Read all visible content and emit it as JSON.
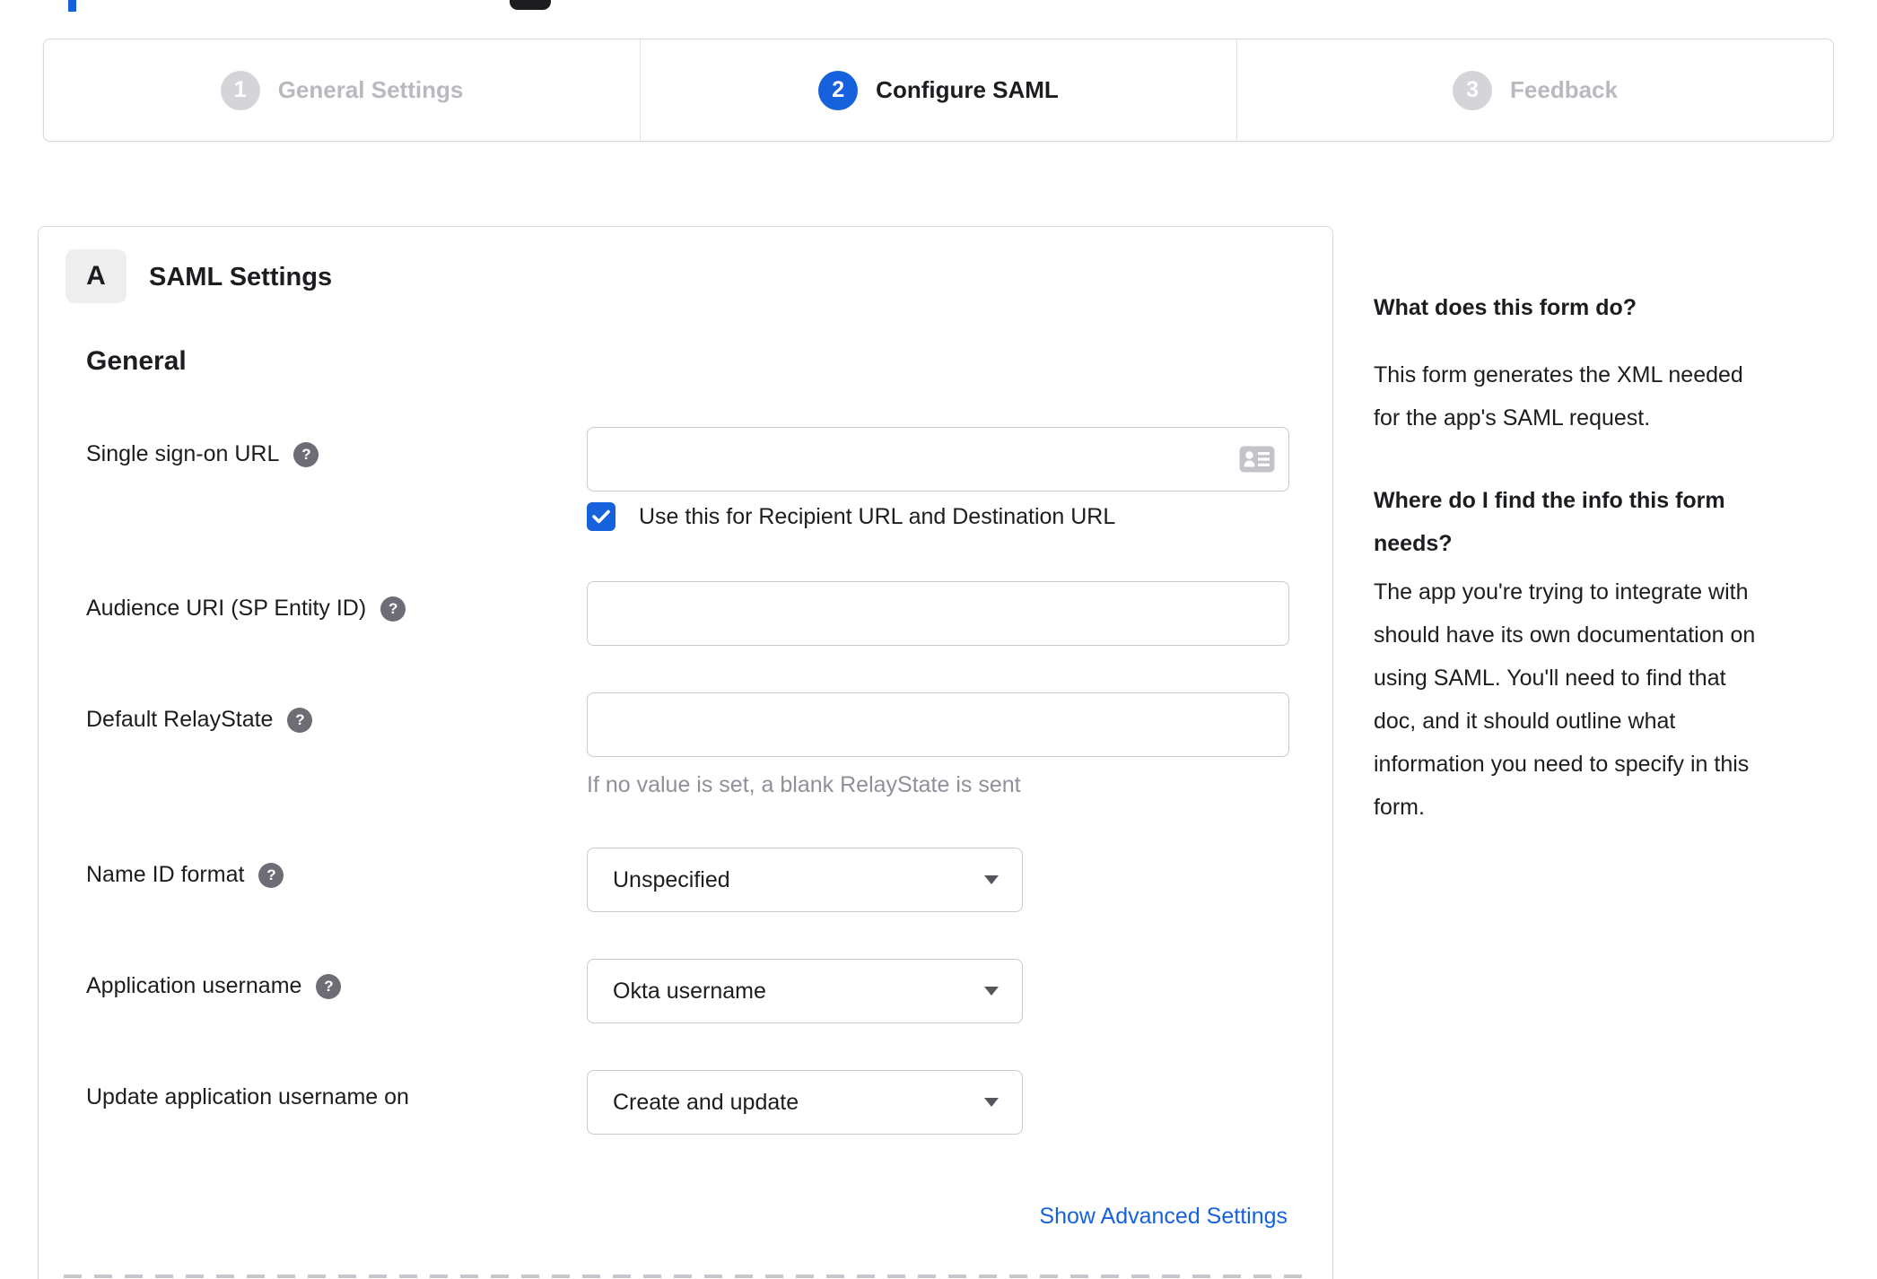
{
  "stepper": {
    "steps": [
      {
        "number": "1",
        "label": "General Settings",
        "state": "inactive"
      },
      {
        "number": "2",
        "label": "Configure SAML",
        "state": "active"
      },
      {
        "number": "3",
        "label": "Feedback",
        "state": "inactive"
      }
    ]
  },
  "panel": {
    "badge": "A",
    "title": "SAML Settings",
    "section_title": "General",
    "fields": {
      "sso_url": {
        "label": "Single sign-on URL",
        "value": "",
        "checkbox_label": "Use this for Recipient URL and Destination URL",
        "checkbox_checked": true
      },
      "audience_uri": {
        "label": "Audience URI (SP Entity ID)",
        "value": ""
      },
      "relay_state": {
        "label": "Default RelayState",
        "value": "",
        "helper": "If no value is set, a blank RelayState is sent"
      },
      "name_id_format": {
        "label": "Name ID format",
        "value": "Unspecified"
      },
      "app_username": {
        "label": "Application username",
        "value": "Okta username"
      },
      "update_app_username": {
        "label": "Update application username on",
        "value": "Create and update"
      }
    },
    "show_advanced_label": "Show Advanced Settings"
  },
  "sidebar": {
    "q1": "What does this form do?",
    "p1_lines": [
      "This form generates the XML needed",
      "for the app's SAML request."
    ],
    "q2_lines": [
      "Where do I find the info this form",
      "needs?"
    ],
    "p2_lines": [
      "The app you're trying to integrate with",
      "should have its own documentation on",
      "using SAML. You'll need to find that",
      "doc, and it should outline what",
      "information you need to specify in this",
      "form."
    ]
  },
  "icons": {
    "help": "question-mark-circle",
    "sso_input": "contact-card-autofill",
    "select": "caret-down",
    "checkbox": "checkmark"
  },
  "colors": {
    "accent_blue": "#1662dd",
    "text_dark": "#1d1d21",
    "inactive_grey": "#b9b9bf",
    "helper_grey": "#90909a",
    "border_grey": "#c9c9cf"
  }
}
